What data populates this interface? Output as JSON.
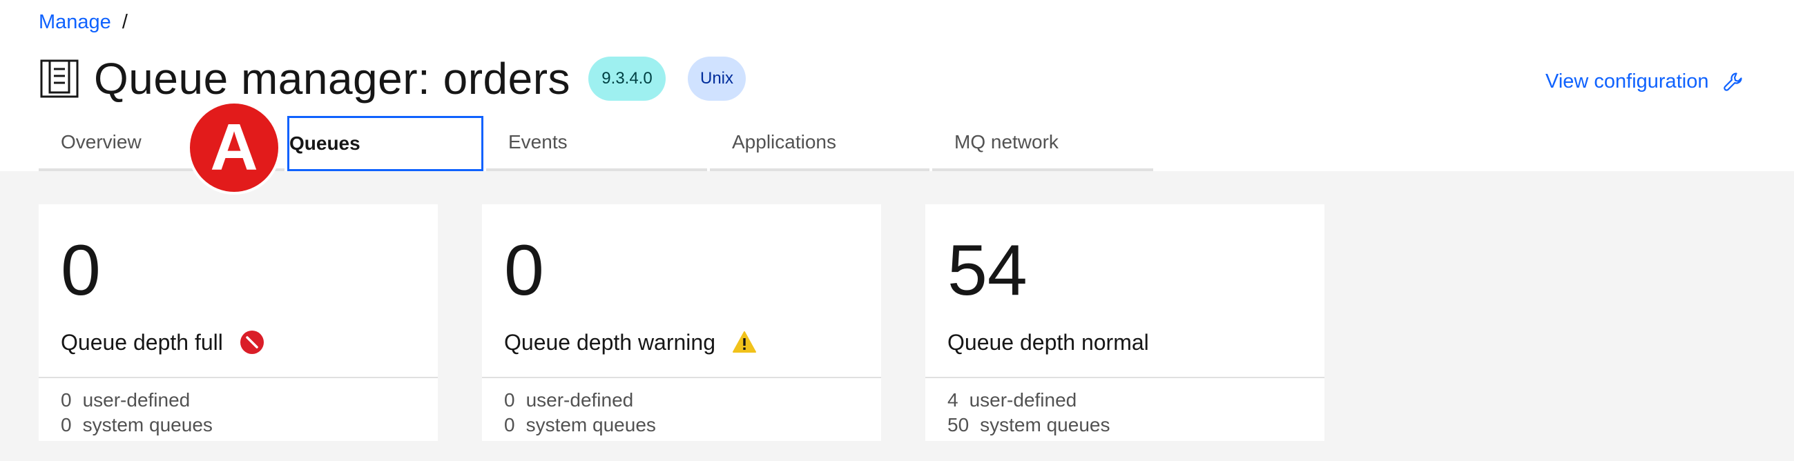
{
  "breadcrumb": {
    "link": "Manage",
    "separator": "/"
  },
  "header": {
    "title": "Queue manager: orders",
    "version_tag": "9.3.4.0",
    "os_tag": "Unix",
    "view_config_label": "View configuration",
    "title_icon": "queue-manager-icon",
    "config_icon": "wrench-icon"
  },
  "tabs": [
    {
      "label": "Overview"
    },
    {
      "label": "Queues",
      "active": true
    },
    {
      "label": "Events"
    },
    {
      "label": "Applications"
    },
    {
      "label": "MQ network"
    }
  ],
  "marker": {
    "label": "A",
    "color": "#e21b1b"
  },
  "tiles": [
    {
      "count": "0",
      "label": "Queue depth full",
      "icon": "error-icon",
      "user_defined_count": "0",
      "user_defined_label": "user-defined",
      "system_count": "0",
      "system_label": "system queues"
    },
    {
      "count": "0",
      "label": "Queue depth warning",
      "icon": "warning-icon",
      "user_defined_count": "0",
      "user_defined_label": "user-defined",
      "system_count": "0",
      "system_label": "system queues"
    },
    {
      "count": "54",
      "label": "Queue depth normal",
      "user_defined_count": "4",
      "user_defined_label": "user-defined",
      "system_count": "50",
      "system_label": "system queues"
    }
  ],
  "colors": {
    "link": "#0f62fe",
    "error": "#da1e28",
    "warning": "#f1c21b",
    "version_tag_bg": "#9ef0f0",
    "os_tag_bg": "#d0e2ff"
  }
}
